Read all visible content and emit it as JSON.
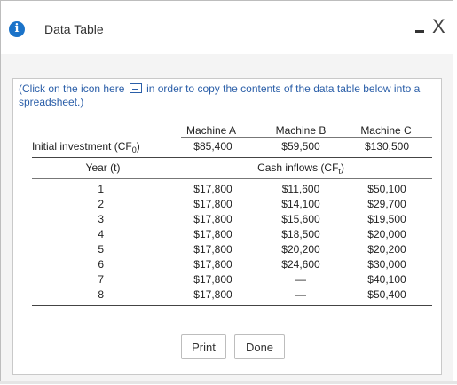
{
  "window": {
    "title": "Data Table",
    "info_icon": "info-icon",
    "minimize_icon": "minimize-icon",
    "close_icon": "close-icon",
    "close_glyph": "X"
  },
  "note": {
    "before_icon": "(Click on the icon here",
    "after_icon": "in order to copy the contents of the data table below into a spreadsheet.)",
    "icon": "copy-table-icon"
  },
  "table": {
    "machine_headers": [
      "Machine A",
      "Machine B",
      "Machine C"
    ],
    "investment_label": "Initial investment (CF",
    "investment_sub": "0",
    "investment_close": ")",
    "investments": [
      "$85,400",
      "$59,500",
      "$130,500"
    ],
    "year_header": "Year (t)",
    "cashflow_header": "Cash inflows (CF",
    "cashflow_sub": "t",
    "cashflow_close": ")",
    "rows": [
      {
        "year": "1",
        "a": "$17,800",
        "b": "$11,600",
        "c": "$50,100"
      },
      {
        "year": "2",
        "a": "$17,800",
        "b": "$14,100",
        "c": "$29,700"
      },
      {
        "year": "3",
        "a": "$17,800",
        "b": "$15,600",
        "c": "$19,500"
      },
      {
        "year": "4",
        "a": "$17,800",
        "b": "$18,500",
        "c": "$20,000"
      },
      {
        "year": "5",
        "a": "$17,800",
        "b": "$20,200",
        "c": "$20,200"
      },
      {
        "year": "6",
        "a": "$17,800",
        "b": "$24,600",
        "c": "$30,000"
      },
      {
        "year": "7",
        "a": "$17,800",
        "b": "—",
        "c": "$40,100"
      },
      {
        "year": "8",
        "a": "$17,800",
        "b": "—",
        "c": "$50,400"
      }
    ]
  },
  "buttons": {
    "print": "Print",
    "done": "Done"
  },
  "colors": {
    "accent": "#1b73c9",
    "link": "#2a5ea8"
  }
}
